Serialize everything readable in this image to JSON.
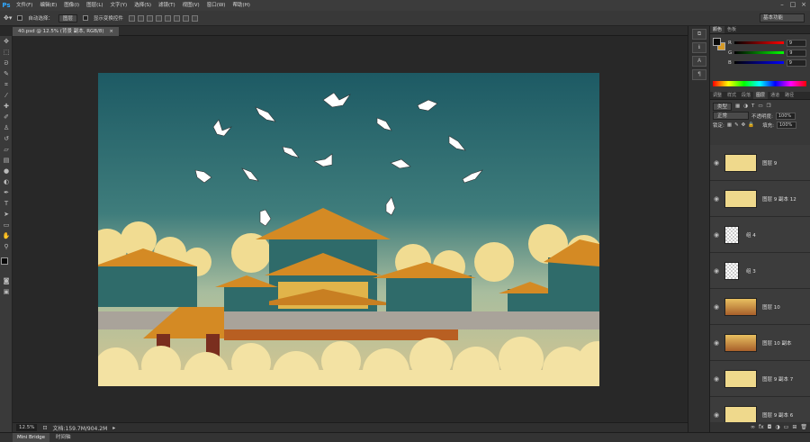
{
  "app": {
    "logo": "Ps"
  },
  "menu": [
    "文件(F)",
    "编辑(E)",
    "图像(I)",
    "图层(L)",
    "文字(Y)",
    "选择(S)",
    "滤镜(T)",
    "视图(V)",
    "窗口(W)",
    "帮助(H)"
  ],
  "window_controls": [
    "minimize-icon",
    "maximize-icon",
    "close-icon"
  ],
  "options": {
    "auto_select_label": "自动选择：",
    "auto_select_value": "图层",
    "show_transform_label": "显示变换控件",
    "workspace": "基本功能"
  },
  "document_tab": "40.psd @ 12.5% (背景 副本, RGB/8)",
  "tools": [
    "move",
    "marquee",
    "lasso",
    "quick-select",
    "crop",
    "eyedropper",
    "heal",
    "brush",
    "stamp",
    "history",
    "eraser",
    "gradient",
    "blur",
    "dodge",
    "pen",
    "type",
    "path-select",
    "shape",
    "hand",
    "zoom"
  ],
  "status": {
    "zoom": "12.5%",
    "doc": "文档:159.7M/904.2M"
  },
  "bottom_tabs": [
    "Mini Bridge",
    "时间轴"
  ],
  "color_panel": {
    "tabs": [
      "颜色",
      "色板"
    ],
    "r": "9",
    "g": "9",
    "b": "9",
    "foreground": "#090909",
    "background": "#d59a26"
  },
  "layers_panel": {
    "tabs": [
      "调整",
      "样式",
      "段落",
      "图层",
      "通道",
      "路径"
    ],
    "filter_kind": "类型",
    "blend_mode": "正常",
    "opacity_label": "不透明度:",
    "opacity": "100%",
    "lock_label": "锁定:",
    "fill_label": "填充:",
    "fill": "100%",
    "layers": [
      {
        "name": "图层 9"
      },
      {
        "name": "图层 9 副本 12"
      },
      {
        "name": "组 4"
      },
      {
        "name": "组 3"
      },
      {
        "name": "图层 10"
      },
      {
        "name": "图层 10 副本"
      },
      {
        "name": "图层 9 副本 7"
      },
      {
        "name": "图层 9 副本 6"
      }
    ]
  }
}
